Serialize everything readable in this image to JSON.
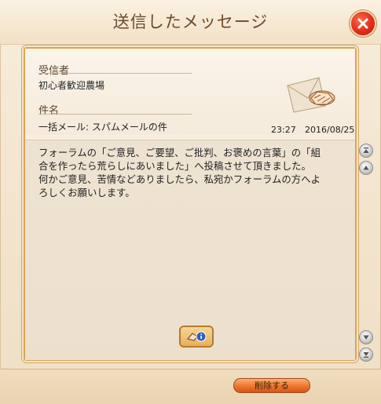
{
  "window": {
    "title": "送信したメッセージ"
  },
  "message": {
    "recipient_label": "受信者",
    "recipient": "初心者歓迎農場",
    "subject_label": "件名",
    "subject": "一括メール: スパムメールの件",
    "time": "23:27",
    "date": "2016/08/25",
    "body_lines": [
      "フォーラムの「ご意見、ご要望、ご批判、お褒めの言葉」の「組",
      "合を作ったら荒らしにあいました」へ投稿させて頂きました。",
      "何かご意見、苦情などありましたら、私宛かフォーラムの方へよ",
      "ろしくお願いします。"
    ]
  },
  "footer": {
    "delete_label": "削除する"
  },
  "colors": {
    "accent": "#f07a2e",
    "close": "#e0301a",
    "border": "#d7a55a"
  },
  "icons": {
    "close": "close-icon",
    "envelope": "envelope-handshake-icon",
    "reply": "reply-info-icon",
    "scroll_top": "scroll-top-icon",
    "scroll_up": "scroll-up-icon",
    "scroll_down": "scroll-down-icon",
    "scroll_bottom": "scroll-bottom-icon"
  }
}
